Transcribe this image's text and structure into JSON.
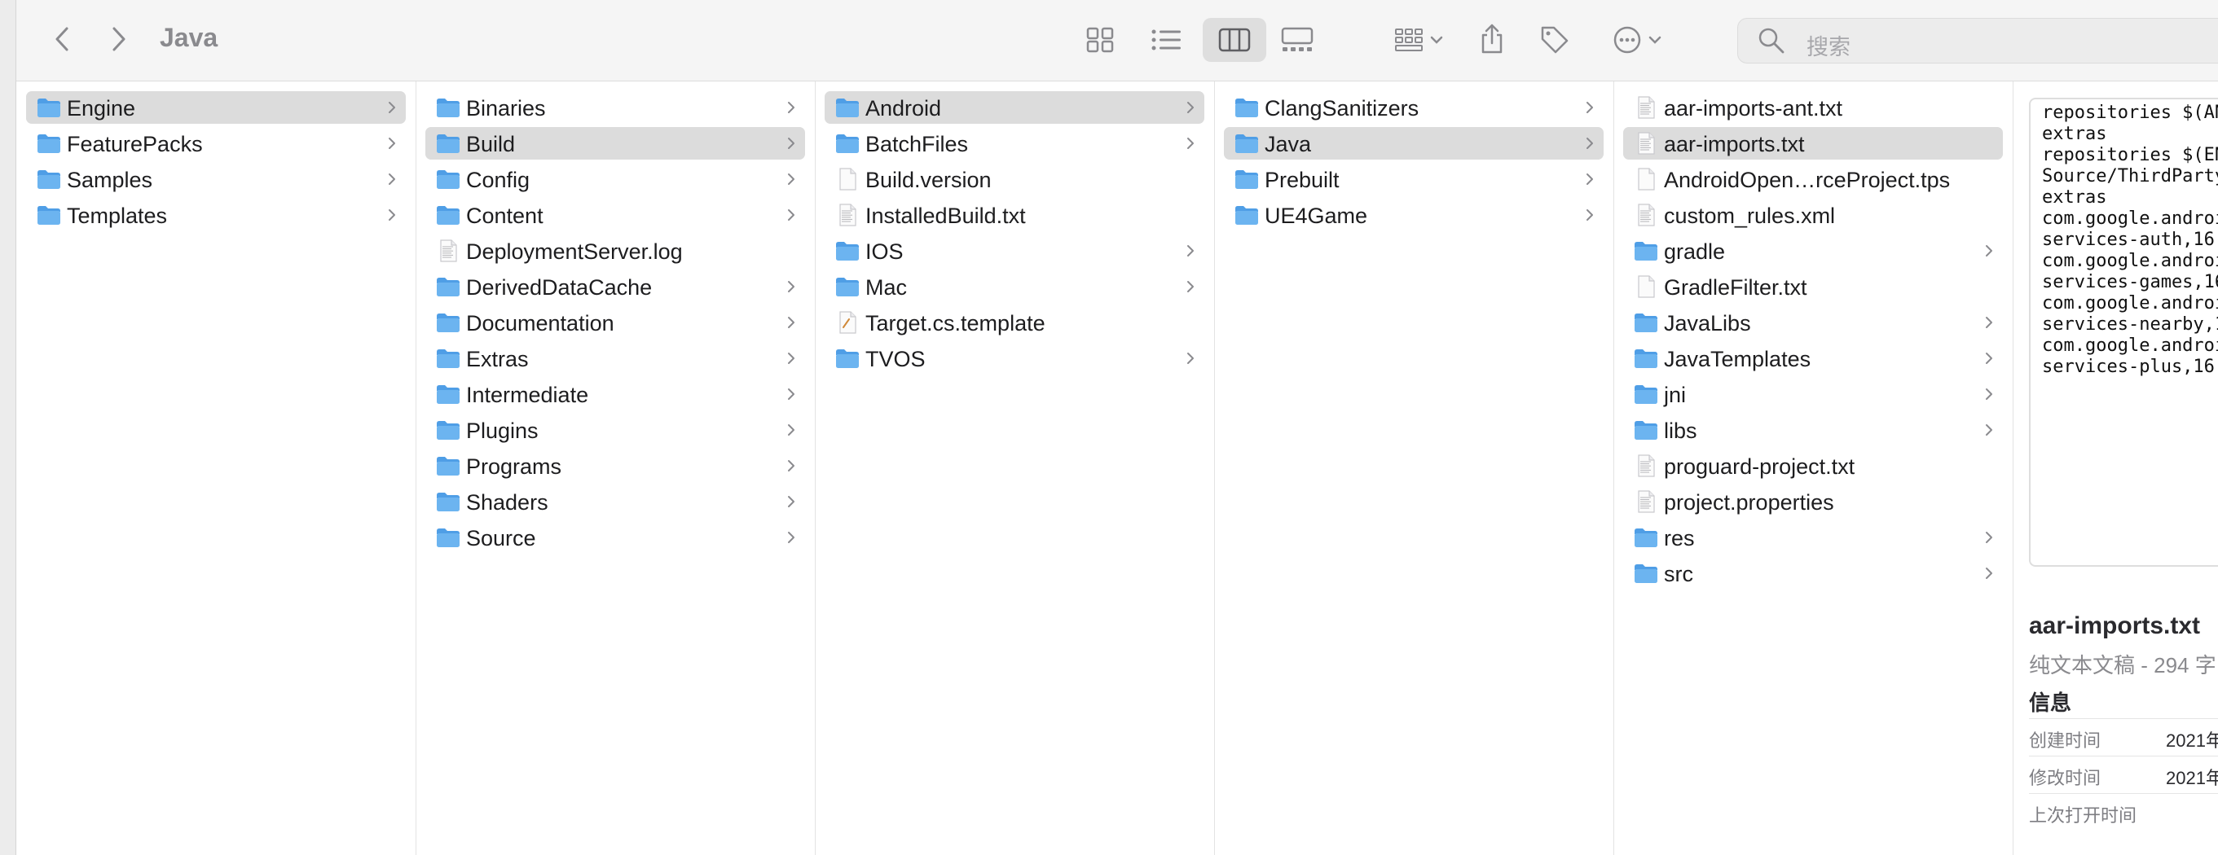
{
  "window": {
    "title": "Java",
    "search_placeholder": "搜索"
  },
  "toolbar": {
    "icons": [
      "chevron-left-icon",
      "chevron-right-icon",
      "grid-view-icon",
      "list-view-icon",
      "column-view-icon",
      "gallery-view-icon",
      "group-icon",
      "share-icon",
      "tag-icon",
      "more-icon"
    ],
    "active_view": "columns"
  },
  "columns": [
    {
      "items": [
        {
          "label": "Engine",
          "kind": "folder",
          "selected": true
        },
        {
          "label": "FeaturePacks",
          "kind": "folder"
        },
        {
          "label": "Samples",
          "kind": "folder"
        },
        {
          "label": "Templates",
          "kind": "folder"
        }
      ]
    },
    {
      "items": [
        {
          "label": "Binaries",
          "kind": "folder"
        },
        {
          "label": "Build",
          "kind": "folder",
          "selected": true
        },
        {
          "label": "Config",
          "kind": "folder"
        },
        {
          "label": "Content",
          "kind": "folder"
        },
        {
          "label": "DeploymentServer.log",
          "kind": "log"
        },
        {
          "label": "DerivedDataCache",
          "kind": "folder"
        },
        {
          "label": "Documentation",
          "kind": "folder"
        },
        {
          "label": "Extras",
          "kind": "folder"
        },
        {
          "label": "Intermediate",
          "kind": "folder"
        },
        {
          "label": "Plugins",
          "kind": "folder"
        },
        {
          "label": "Programs",
          "kind": "folder"
        },
        {
          "label": "Shaders",
          "kind": "folder"
        },
        {
          "label": "Source",
          "kind": "folder"
        }
      ]
    },
    {
      "items": [
        {
          "label": "Android",
          "kind": "folder",
          "selected": true
        },
        {
          "label": "BatchFiles",
          "kind": "folder"
        },
        {
          "label": "Build.version",
          "kind": "file"
        },
        {
          "label": "InstalledBuild.txt",
          "kind": "text"
        },
        {
          "label": "IOS",
          "kind": "folder"
        },
        {
          "label": "Mac",
          "kind": "folder"
        },
        {
          "label": "Target.cs.template",
          "kind": "script"
        },
        {
          "label": "TVOS",
          "kind": "folder"
        }
      ]
    },
    {
      "items": [
        {
          "label": "ClangSanitizers",
          "kind": "folder"
        },
        {
          "label": "Java",
          "kind": "folder",
          "selected": true
        },
        {
          "label": "Prebuilt",
          "kind": "folder"
        },
        {
          "label": "UE4Game",
          "kind": "folder"
        }
      ]
    },
    {
      "items": [
        {
          "label": "aar-imports-ant.txt",
          "kind": "text"
        },
        {
          "label": "aar-imports.txt",
          "kind": "text",
          "selected": true
        },
        {
          "label": "AndroidOpen…rceProject.tps",
          "kind": "file"
        },
        {
          "label": "custom_rules.xml",
          "kind": "text"
        },
        {
          "label": "gradle",
          "kind": "folder"
        },
        {
          "label": "GradleFilter.txt",
          "kind": "file"
        },
        {
          "label": "JavaLibs",
          "kind": "folder"
        },
        {
          "label": "JavaTemplates",
          "kind": "folder"
        },
        {
          "label": "jni",
          "kind": "folder"
        },
        {
          "label": "libs",
          "kind": "folder"
        },
        {
          "label": "proguard-project.txt",
          "kind": "text"
        },
        {
          "label": "project.properties",
          "kind": "text"
        },
        {
          "label": "res",
          "kind": "folder"
        },
        {
          "label": "src",
          "kind": "folder"
        }
      ]
    }
  ],
  "preview": {
    "text_lines": [
      "repositories $(AN",
      "extras",
      "repositories $(EN",
      "Source/ThirdParty",
      "extras",
      "com.google.androi",
      "services-auth,16",
      "com.google.androi",
      "services-games,16",
      "com.google.androi",
      "services-nearby,1",
      "com.google.androi",
      "services-plus,16"
    ],
    "file_name": "aar-imports.txt",
    "file_type": "纯文本文稿 - 294 字",
    "info_heading": "信息",
    "info": [
      {
        "key": "创建时间",
        "value": "2021年"
      },
      {
        "key": "修改时间",
        "value": "2021年"
      },
      {
        "key": "上次打开时间",
        "value": ""
      }
    ]
  },
  "colors": {
    "folder_blue": "#6cb4f0",
    "folder_blue_dark": "#4f9ee6",
    "selection": "#dcdcdc",
    "toolbar_bg": "#f5f5f5",
    "icon_gray": "#8a8a8e"
  }
}
